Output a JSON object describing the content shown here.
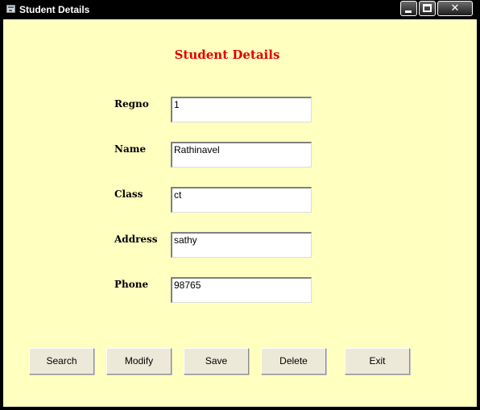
{
  "window": {
    "title": "Student Details"
  },
  "form": {
    "heading": "Student Details",
    "fields": [
      {
        "label": "Regno",
        "value": "1"
      },
      {
        "label": "Name",
        "value": "Rathinavel"
      },
      {
        "label": "Class",
        "value": "ct"
      },
      {
        "label": "Address",
        "value": "sathy"
      },
      {
        "label": "Phone",
        "value": "98765"
      }
    ]
  },
  "buttons": {
    "search": "Search",
    "modify": "Modify",
    "save": "Save",
    "delete": "Delete",
    "exit": "Exit"
  },
  "colors": {
    "form_background": "#ffffc0",
    "heading": "#e00000",
    "window_frame": "#000000"
  },
  "icons": {
    "app": "app-icon",
    "minimize": "minimize-icon",
    "maximize": "maximize-icon",
    "close": "close-icon"
  }
}
